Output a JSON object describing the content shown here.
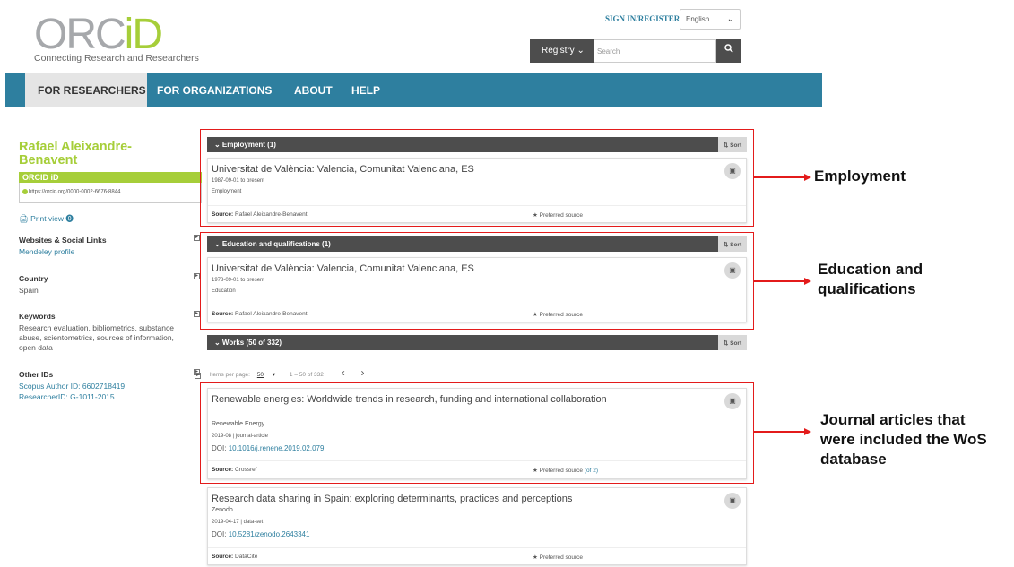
{
  "header": {
    "logo_prefix": "ORC",
    "logo_id": "iD",
    "tagline": "Connecting Research and Researchers",
    "signin_label": "SIGN IN/REGISTER",
    "language": "English",
    "registry_label": "Registry ⌄",
    "search_placeholder": "Search"
  },
  "nav": {
    "items": [
      {
        "label": "FOR RESEARCHERS"
      },
      {
        "label": "FOR ORGANIZATIONS"
      },
      {
        "label": "ABOUT"
      },
      {
        "label": "HELP"
      }
    ]
  },
  "profile": {
    "name": "Rafael Aleixandre-Benavent",
    "orcid_label": "ORCID iD",
    "orcid_url": "https://orcid.org/0000-0002-6676-8844",
    "print_view": "🖨 Print view ⓿",
    "websites_title": "Websites & Social Links",
    "websites_link": "Mendeley profile",
    "country_title": "Country",
    "country_value": "Spain",
    "keywords_title": "Keywords",
    "keywords_value": "Research evaluation, bibliometrics, substance abuse, scientometrics, sources of information, open data",
    "other_ids_title": "Other IDs",
    "scopus_id": "Scopus Author ID: 6602718419",
    "researcher_id": "ResearcherID: G-1011-2015"
  },
  "employment": {
    "heading": "⌄ Employment (1)",
    "sort": "⇅ Sort",
    "title": "Universitat de València: Valencia, Comunitat Valenciana, ES",
    "dates": "1987-09-01 to present",
    "type": "Employment",
    "source_label": "Source:",
    "source": "Rafael Aleixandre-Benavent",
    "preferred": "★ Preferred source"
  },
  "education": {
    "heading": "⌄ Education and qualifications (1)",
    "sort": "⇅ Sort",
    "title": "Universitat de València: Valencia, Comunitat Valenciana, ES",
    "dates": "1978-09-01 to present",
    "type": "Education",
    "source_label": "Source:",
    "source": "Rafael Aleixandre-Benavent",
    "preferred": "★ Preferred source"
  },
  "works": {
    "heading": "⌄ Works (50 of 332)",
    "sort": "⇅ Sort",
    "items_per_page_label": "Items per page:",
    "items_per_page": "50",
    "range": "1 – 50 of 332",
    "items": [
      {
        "title": "Renewable energies: Worldwide trends in research, funding and international collaboration",
        "journal": "Renewable Energy",
        "meta": "2019-08 | journal-article",
        "doi_label": "DOI:",
        "doi": "10.1016/j.renene.2019.02.079",
        "source_label": "Source:",
        "source": "Crossref",
        "preferred": "★ Preferred source",
        "preferred_of": "(of 2)"
      },
      {
        "title": "Research data sharing in Spain: exploring determinants, practices and perceptions",
        "journal": "Zenodo",
        "meta": "2019-04-17 | data-set",
        "doi_label": "DOI:",
        "doi": "10.5281/zenodo.2643341",
        "source_label": "Source:",
        "source": "DataCite",
        "preferred": "★ Preferred source"
      }
    ]
  },
  "annotations": {
    "employment": "Employment",
    "education_line1": "Education and",
    "education_line2": "qualifications",
    "journal_line1": "Journal articles that",
    "journal_line2": "were included the WoS",
    "journal_line3": "database"
  },
  "colors": {
    "orcid_green": "#a6ce39",
    "nav_blue": "#2e7f9f",
    "highlight_red": "#e31b1b",
    "panel_dark": "#4d4d4d"
  }
}
